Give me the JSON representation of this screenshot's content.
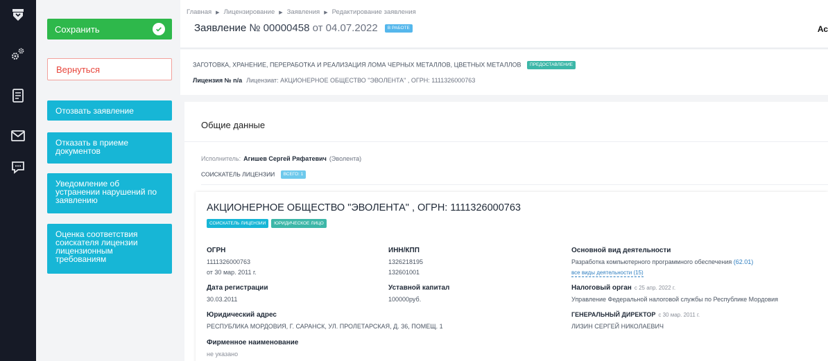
{
  "rail": {
    "icons": [
      "logo-icon",
      "settings-icon",
      "document-list-icon",
      "mail-icon",
      "chat-icon"
    ]
  },
  "actions": {
    "save_label": "Сохранить",
    "back_label": "Вернуться",
    "buttons": [
      "Отозвать заявление",
      "Отказать в приеме документов",
      "Уведомление об устранении нарушений по заявлению",
      "Оценка соответствия соискателя лицензии лицензионным требованиям"
    ]
  },
  "breadcrumb": [
    "Главная",
    "Лицензирование",
    "Заявления",
    "Редактирование заявления"
  ],
  "header": {
    "title_prefix": "Заявление",
    "number": "№ 00000458",
    "date": "от 04.07.2022",
    "status": "В РАБОТЕ",
    "cut_text": "Ас"
  },
  "license": {
    "activity": "ЗАГОТОВКА, ХРАНЕНИЕ, ПЕРЕРАБОТКА И РЕАЛИЗАЦИЯ ЛОМА ЧЕРНЫХ МЕТАЛЛОВ, ЦВЕТНЫХ МЕТАЛЛОВ",
    "activity_badge": "ПРЕДОСТАВЛЕНИЕ",
    "number_label": "Лицензия № n/a",
    "holder": "Лицензиат: АКЦИОНЕРНОЕ ОБЩЕСТВО \"ЭВОЛЕНТА\" , ОГРН: 1111326000763"
  },
  "general": {
    "heading": "Общие данные",
    "executor_label": "Исполнитель:",
    "executor_name": "Агишев Сергей Ряфатевич",
    "executor_org": "(Эволента)",
    "applicant_label": "СОИСКАТЕЛЬ ЛИЦЕНЗИИ",
    "applicant_count": "ВСЕГО: 1"
  },
  "org": {
    "title": "АКЦИОНЕРНОЕ ОБЩЕСТВО \"ЭВОЛЕНТА\" , ОГРН: 1111326000763",
    "badges": [
      "СОИСКАТЕЛЬ ЛИЦЕНЗИИ",
      "ЮРИДИЧЕСКОЕ ЛИЦО"
    ],
    "ogrn_label": "ОГРН",
    "ogrn": "1111326000763",
    "ogrn_date": "от 30 мар. 2011 г.",
    "reg_label": "Дата регистрации",
    "reg_date": "30.03.2011",
    "address_label": "Юридический адрес",
    "address": "РЕСПУБЛИКА МОРДОВИЯ, Г. САРАНСК, УЛ. ПРОЛЕТАРСКАЯ, Д. 36, ПОМЕЩ. 1",
    "firm_label": "Фирменное наименование",
    "firm": "не указано",
    "inn_label": "ИНН/КПП",
    "inn": "1326218195",
    "kpp": "132601001",
    "capital_label": "Уставной капитал",
    "capital": "100000руб.",
    "activity_label": "Основной вид деятельности",
    "activity": "Разработка компьютерного программного обеспечения",
    "activity_code": "(62.01)",
    "all_activities": "все виды деятельности (15)",
    "tax_label": "Налоговый орган",
    "tax_since": "с 25 апр. 2022 г.",
    "tax": "Управление Федеральной налоговой службы по Республике Мордовия",
    "director_label": "ГЕНЕРАЛЬНЫЙ ДИРЕКТОР",
    "director_since": "с 30 мар. 2011 г.",
    "director": "ЛИЗИН СЕРГЕЙ НИКОЛАЕВИЧ"
  },
  "colors": {
    "rail": "#161a26",
    "save": "#2eb84b",
    "back_border": "#f2a09b",
    "action": "#17b6d6",
    "status_badge": "#55b7ec",
    "teal_badge": "#3db7a8",
    "link": "#2f7fc1"
  }
}
